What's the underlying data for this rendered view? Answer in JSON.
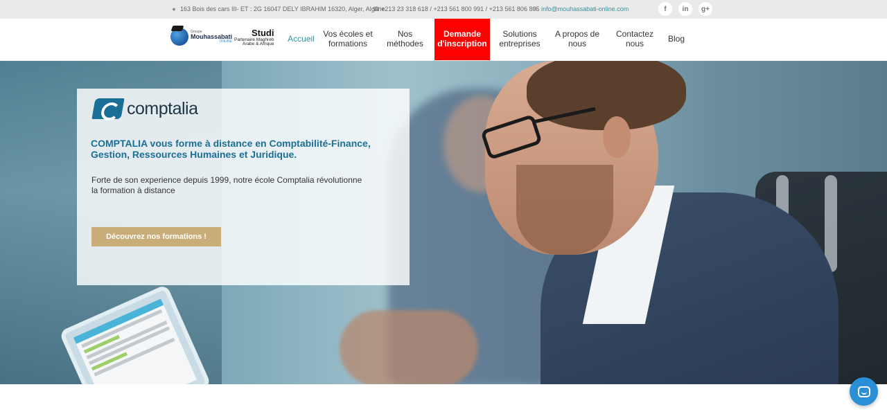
{
  "topbar": {
    "address": "163 Bois des cars III- ET : 2G 16047 DELY IBRAHIM 16320, Alger, Algérie.",
    "phones": "+213 23 318 618 / +213 561 800 991 / +213 561 806 805",
    "email": "info@mouhassabati-online.com",
    "icons": {
      "location": "map-pin-icon",
      "phone": "phone-icon",
      "email": "envelope-icon"
    },
    "social": [
      {
        "name": "facebook",
        "glyph": "f"
      },
      {
        "name": "linkedin",
        "glyph": "in"
      },
      {
        "name": "googleplus",
        "glyph": "g+"
      }
    ]
  },
  "header": {
    "logo_group": {
      "small": "Groupe",
      "name": "Mouhassabati",
      "online": "ONLINE"
    },
    "logo_partner": {
      "name": "Studi",
      "line1": "Partenaire Maghreb",
      "line2": "Arabe & Afrique"
    },
    "nav": [
      {
        "label": "Accueil",
        "active": true
      },
      {
        "label": "Vos écoles et formations"
      },
      {
        "label": "Nos méthodes"
      },
      {
        "label": "Demande d'inscription",
        "highlight": true
      },
      {
        "label": "Solutions entreprises"
      },
      {
        "label": "A propos de nous"
      },
      {
        "label": "Contactez nous"
      },
      {
        "label": "Blog"
      }
    ]
  },
  "hero": {
    "brand": "comptalia",
    "headline": "COMPTALIA vous forme à distance en Comptabilité-Finance, Gestion, Ressources Humaines et Juridique.",
    "description": "Forte de son experience depuis 1999, notre école Comptalia révolutionne la formation à distance",
    "cta_label": "Découvrez nos formations !"
  },
  "colors": {
    "accent": "#3a8f9c",
    "cta_red": "#ff0000",
    "button_gold": "#c8ad79",
    "headline_blue": "#1a6f96",
    "chat_blue": "#2a8fd6"
  },
  "chat": {
    "icon": "chat-bubble-icon"
  }
}
